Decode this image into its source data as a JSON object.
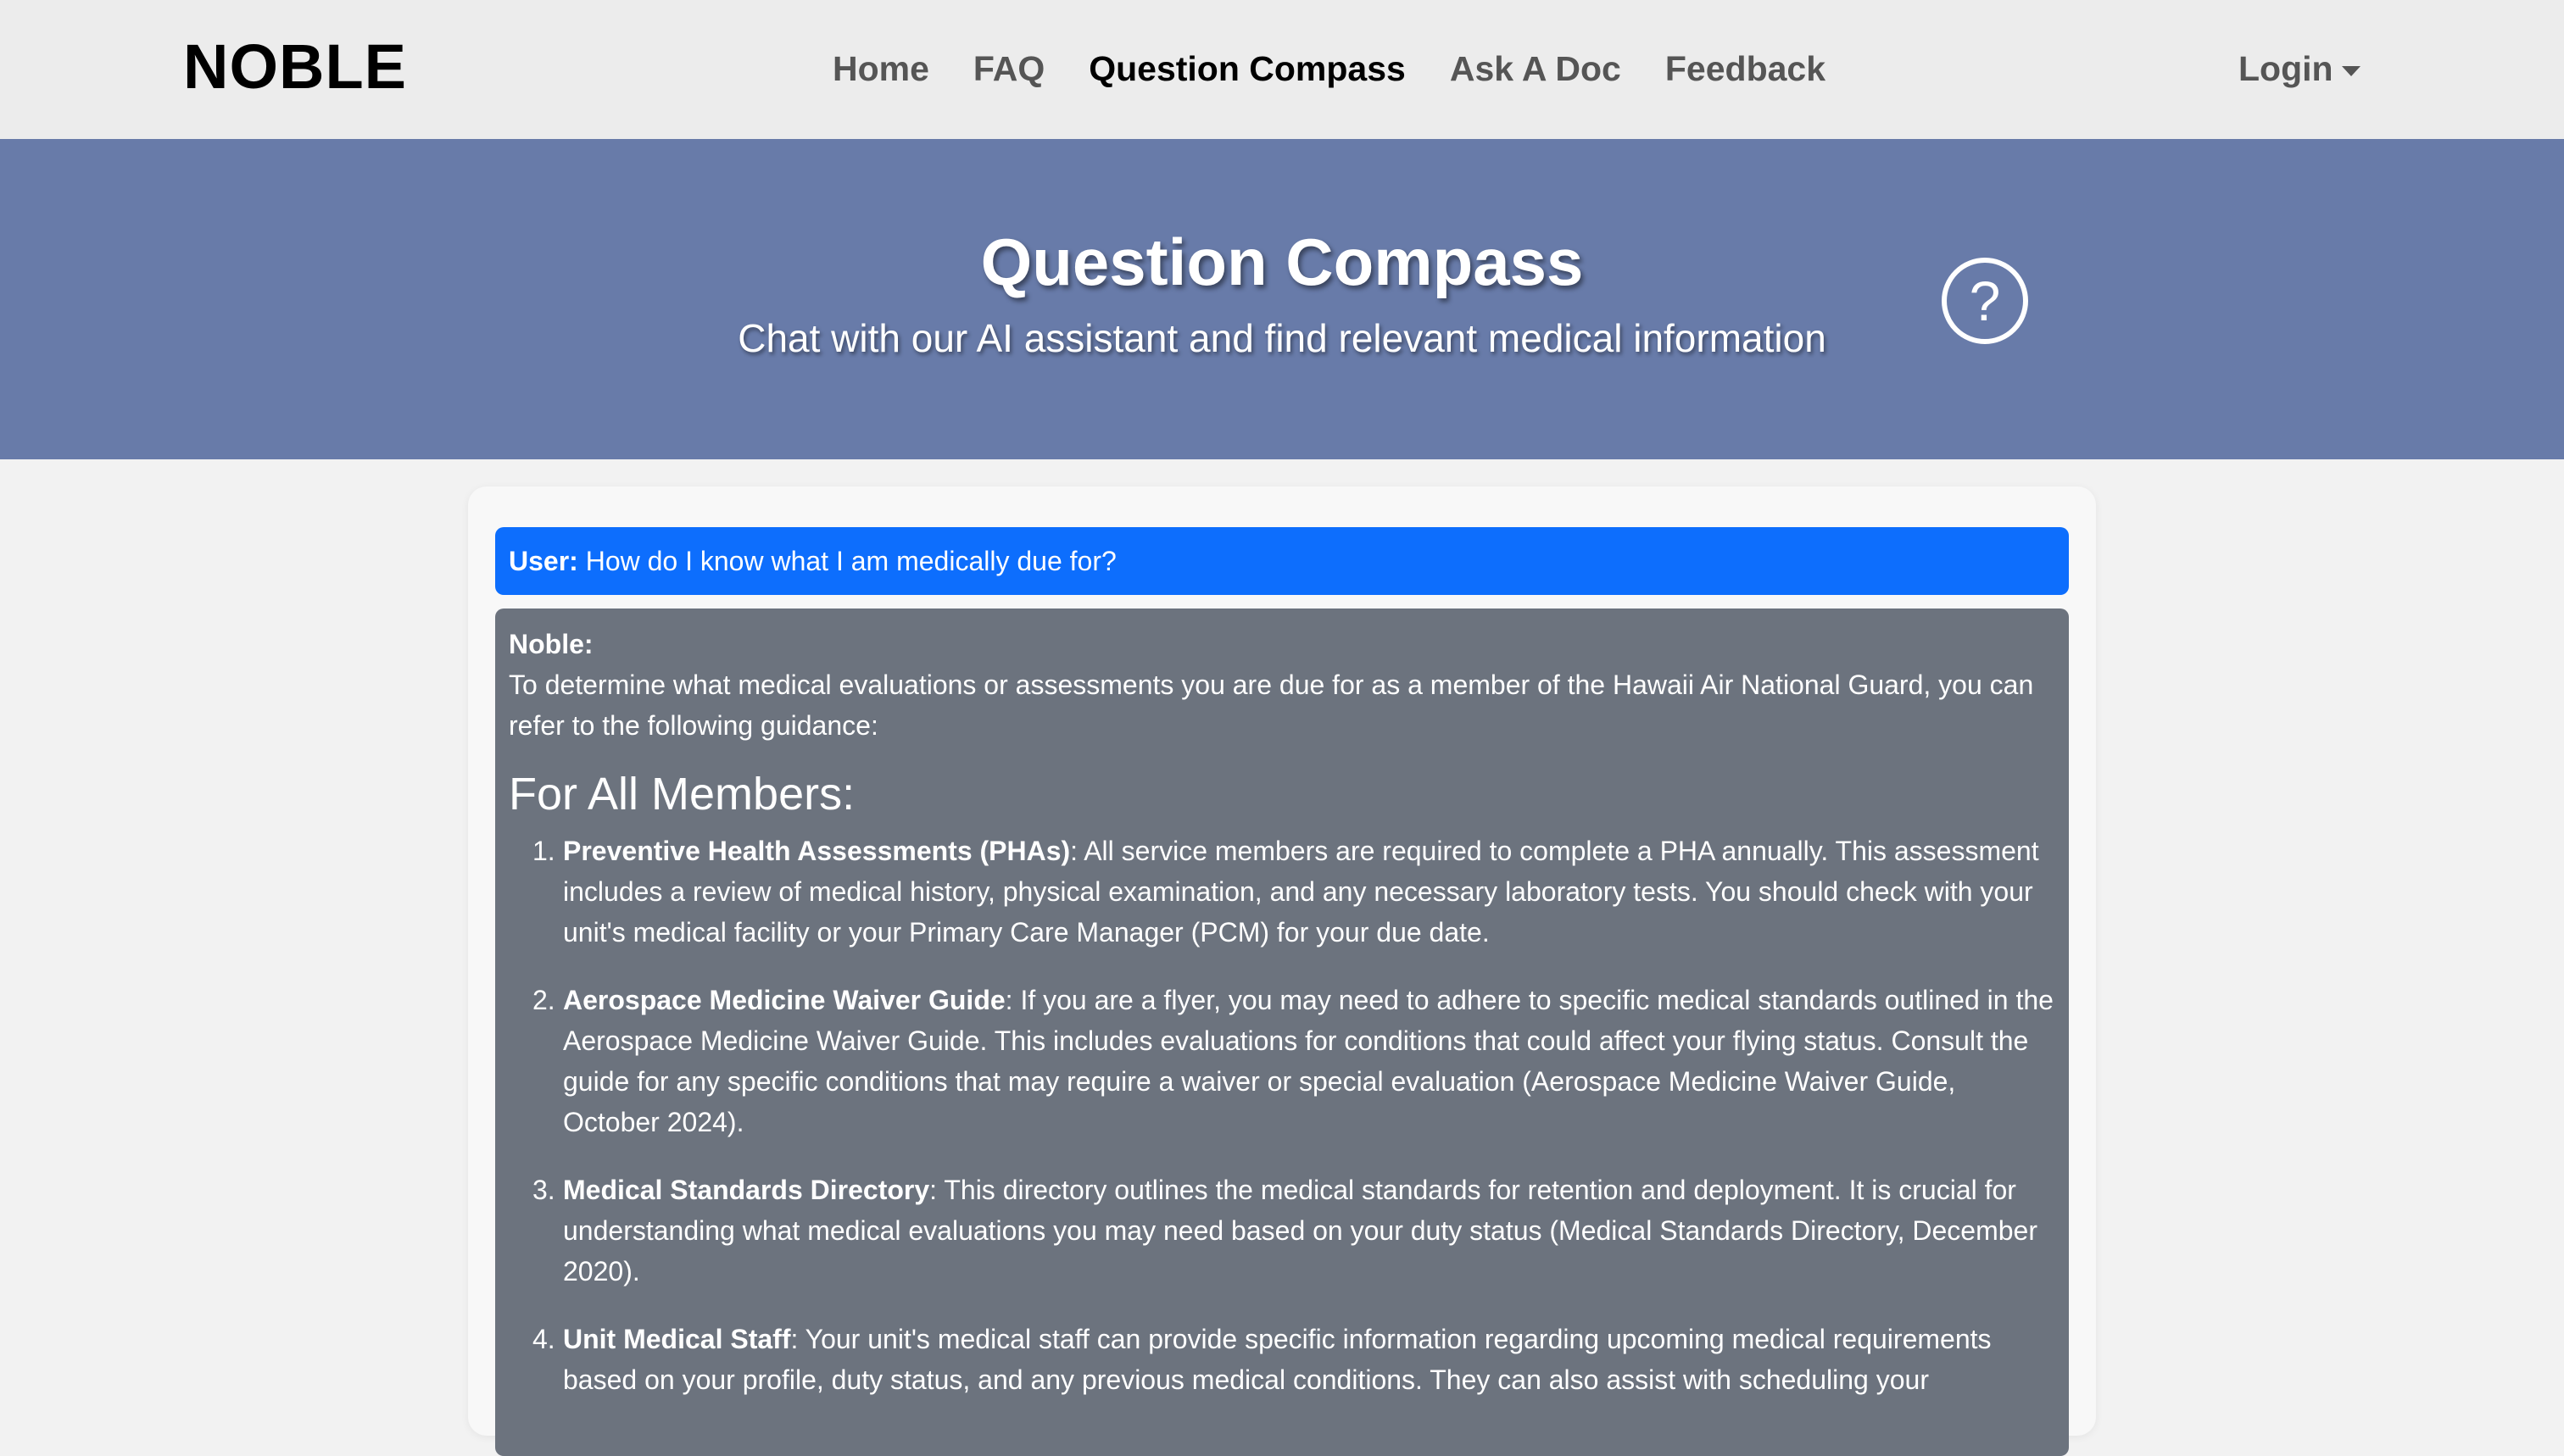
{
  "navbar": {
    "brand": "NOBLE",
    "links": [
      {
        "label": "Home"
      },
      {
        "label": "FAQ"
      },
      {
        "label": "Question Compass"
      },
      {
        "label": "Ask A Doc"
      },
      {
        "label": "Feedback"
      }
    ],
    "active": "Question Compass",
    "login_label": "Login"
  },
  "hero": {
    "title": "Question Compass",
    "subtitle": "Chat with our AI assistant and find relevant medical information",
    "help_icon": "question-circle-icon"
  },
  "chat": {
    "user": {
      "label": "User:",
      "text": "How do I know what I am medically due for?"
    },
    "bot": {
      "label": "Noble:",
      "intro": "To determine what medical evaluations or assessments you are due for as a member of the Hawaii Air National Guard, you can refer to the following guidance:",
      "heading": "For All Members:",
      "items": [
        {
          "num": "1.",
          "title": "Preventive Health Assessments (PHAs)",
          "text": ": All service members are required to complete a PHA annually. This assessment includes a review of medical history, physical examination, and any necessary laboratory tests. You should check with your unit's medical facility or your Primary Care Manager (PCM) for your due date."
        },
        {
          "num": "2.",
          "title": "Aerospace Medicine Waiver Guide",
          "text": ": If you are a flyer, you may need to adhere to specific medical standards outlined in the Aerospace Medicine Waiver Guide. This includes evaluations for conditions that could affect your flying status. Consult the guide for any specific conditions that may require a waiver or special evaluation (Aerospace Medicine Waiver Guide, October 2024)."
        },
        {
          "num": "3.",
          "title": "Medical Standards Directory",
          "text": ": This directory outlines the medical standards for retention and deployment. It is crucial for understanding what medical evaluations you may need based on your duty status (Medical Standards Directory, December 2020)."
        },
        {
          "num": "4.",
          "title": "Unit Medical Staff",
          "text": ": Your unit's medical staff can provide specific information regarding upcoming medical requirements based on your profile, duty status, and any previous medical conditions. They can also assist with scheduling your"
        }
      ]
    }
  },
  "colors": {
    "navbar_bg": "#ececec",
    "hero_bg": "#687ba9",
    "user_bubble": "#0d6efd",
    "bot_bubble": "#6c737e"
  }
}
